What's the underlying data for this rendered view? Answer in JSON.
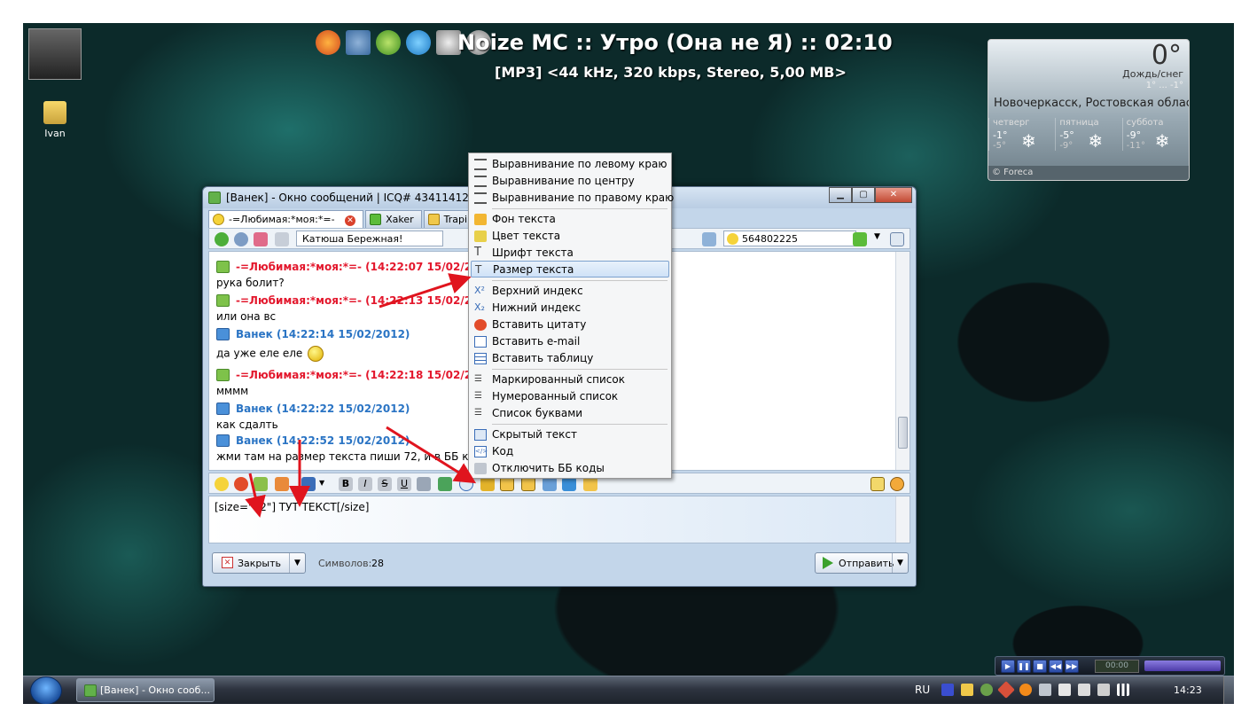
{
  "desktop": {
    "icons": [
      {
        "label": "Ivan"
      }
    ]
  },
  "player": {
    "now_playing": "Noize MC :: Утро (Она не Я) :: 02:10",
    "track_info": "[MP3] <44 kHz, 320 kbps, Stereo, 5,00 MB>",
    "mini_time": "00:00"
  },
  "weather": {
    "temp": "0°",
    "condition": "Дождь/снег",
    "range": "1° ... -1°",
    "city": "Новочеркасск, Ростовская область",
    "days": [
      {
        "name": "четверг",
        "hi": "-1°",
        "lo": "-5°"
      },
      {
        "name": "пятница",
        "hi": "-5°",
        "lo": "-9°"
      },
      {
        "name": "суббота",
        "hi": "-9°",
        "lo": "-11°"
      }
    ],
    "brand": "© Foreca"
  },
  "window": {
    "title": "[Ванек] - Окно сообщений | ICQ# 434114127",
    "tabs": [
      {
        "label": "-=Любимая:*моя:*=-",
        "active": true
      },
      {
        "label": "Xaker",
        "active": false
      },
      {
        "label": "Trapik",
        "active": false
      }
    ],
    "contact_name": "Катюша Бережная!",
    "uin": "564802225",
    "history": [
      {
        "kind": "head",
        "who": "her",
        "text": "-=Любимая:*моя:*=- (14:22:07 15/02/2012)"
      },
      {
        "kind": "text",
        "text": "рука болит?"
      },
      {
        "kind": "head",
        "who": "her",
        "text": "-=Любимая:*моя:*=- (14:22:13 15/02/2012)"
      },
      {
        "kind": "text",
        "text": "или она вс"
      },
      {
        "kind": "head",
        "who": "me",
        "text": "Ванек (14:22:14 15/02/2012)"
      },
      {
        "kind": "text",
        "text": "да уже еле еле"
      },
      {
        "kind": "head",
        "who": "her",
        "text": "-=Любимая:*моя:*=- (14:22:18 15/02/2012)"
      },
      {
        "kind": "text",
        "text": "мммм"
      },
      {
        "kind": "head",
        "who": "me",
        "text": "Ванек (14:22:22 15/02/2012)"
      },
      {
        "kind": "text",
        "text": "как сдалть"
      },
      {
        "kind": "head",
        "who": "me",
        "text": "Ванек (14:22:52 15/02/2012)"
      },
      {
        "kind": "text",
        "text": "жми там на размер текста пиши 72, и в ББ коде"
      }
    ],
    "compose_text": "[size=\"72\"] ТУТ ТЕКСТ[/size]",
    "close_label": "Закрыть",
    "chars_label": "Символов:",
    "chars_count": "28",
    "send_label": "Отправить"
  },
  "context_menu": {
    "items": [
      {
        "label": "Выравнивание по левому краю",
        "icon": "align-left-icon"
      },
      {
        "label": "Выравнивание по центру",
        "icon": "align-center-icon"
      },
      {
        "label": "Выравнивание по правому краю",
        "icon": "align-right-icon"
      },
      {
        "label": "Фон текста",
        "icon": "paint-bucket-icon"
      },
      {
        "label": "Цвет текста",
        "icon": "text-color-icon"
      },
      {
        "label": "Шрифт текста",
        "icon": "font-icon"
      },
      {
        "label": "Размер текста",
        "icon": "font-size-icon",
        "highlighted": true
      },
      {
        "label": "Верхний индекс",
        "icon": "superscript-icon"
      },
      {
        "label": "Нижний индекс",
        "icon": "subscript-icon"
      },
      {
        "label": "Вставить цитату",
        "icon": "quote-icon"
      },
      {
        "label": "Вставить e-mail",
        "icon": "email-icon"
      },
      {
        "label": "Вставить таблицу",
        "icon": "table-icon"
      },
      {
        "label": "Маркированный список",
        "icon": "bullet-list-icon"
      },
      {
        "label": "Нумерованный список",
        "icon": "numbered-list-icon"
      },
      {
        "label": "Список буквами",
        "icon": "letter-list-icon"
      },
      {
        "label": "Скрытый текст",
        "icon": "hidden-text-icon"
      },
      {
        "label": "Код",
        "icon": "code-icon"
      },
      {
        "label": "Отключить ББ коды",
        "icon": "disable-bbcode-icon"
      }
    ]
  },
  "taskbar": {
    "task_label": "[Ванек] - Окно сооб...",
    "lang": "RU",
    "clock": "14:23"
  },
  "colors": {
    "her_name": "#e3182d",
    "my_name": "#2a74c4",
    "arrow": "#e0141e",
    "menu_highlight": "#cfe2f7"
  }
}
